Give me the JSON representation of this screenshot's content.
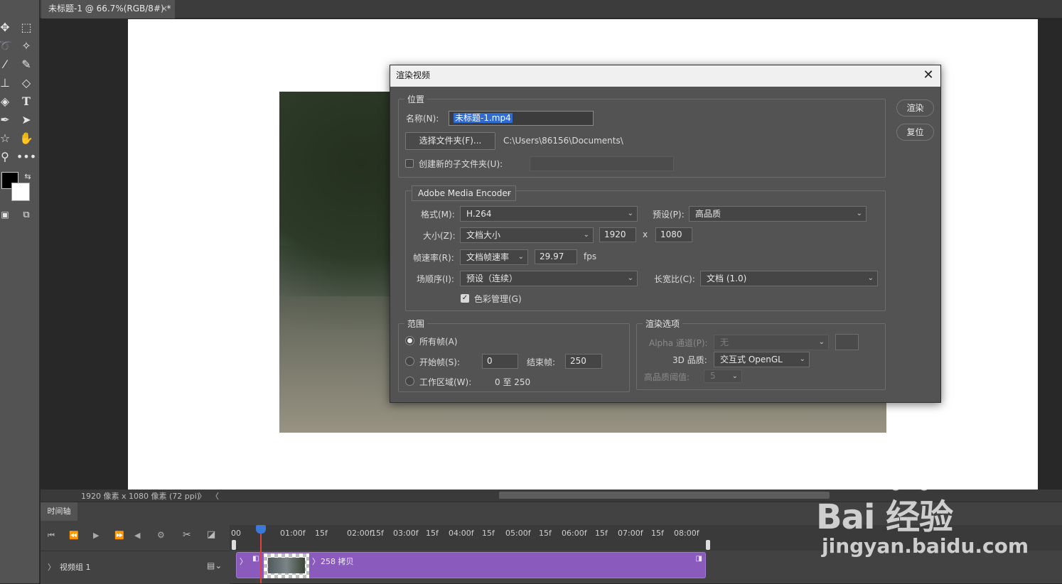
{
  "document_tab": {
    "title": "未标题-1 @ 66.7%(RGB/8#) *",
    "close": "×"
  },
  "status_bar": {
    "doc_info": "1920 像素 x 1080 像素 (72 ppi)",
    "arrow": "〉",
    "scroll_left": "〈"
  },
  "timeline": {
    "panel_title": "时间轴",
    "ticks": [
      "00",
      "01:00f",
      "15f",
      "02:00f",
      "15f",
      "03:00f",
      "15f",
      "04:00f",
      "15f",
      "05:00f",
      "15f",
      "06:00f",
      "15f",
      "07:00f",
      "15f",
      "08:00f"
    ],
    "track_label": "视频组 1",
    "clip_label": "258 拷贝"
  },
  "dialog": {
    "title": "渲染视频",
    "close": "✕",
    "location": {
      "legend": "位置",
      "name_label": "名称(N):",
      "name_value": "未标题-1.mp4",
      "select_folder_button": "选择文件夹(F)...",
      "folder_path": "C:\\Users\\86156\\Documents\\",
      "create_subfolder_label": "创建新的子文件夹(U):",
      "create_subfolder_checked": false,
      "subfolder_value": ""
    },
    "encoder": {
      "selector": "Adobe Media Encoder",
      "format_label": "格式(M):",
      "format_value": "H.264",
      "preset_label": "预设(P):",
      "preset_value": "高品质",
      "size_label": "大小(Z):",
      "size_value": "文档大小",
      "width": "1920",
      "size_x": "x",
      "height": "1080",
      "framerate_label": "帧速率(R):",
      "framerate_value": "文档帧速率",
      "fps_value": "29.97",
      "fps_unit": "fps",
      "field_order_label": "场顺序(I):",
      "field_order_value": "预设（连续）",
      "aspect_label": "长宽比(C):",
      "aspect_value": "文档 (1.0)",
      "color_mgmt_label": "色彩管理(G)",
      "color_mgmt_checked": true
    },
    "range": {
      "legend": "范围",
      "all_frames": "所有帧(A)",
      "start_frame_label": "开始帧(S):",
      "start_frame_value": "0",
      "end_frame_label": "结束帧:",
      "end_frame_value": "250",
      "work_area_label": "工作区域(W):",
      "work_area_value": "0 至 250",
      "selected": "all_frames"
    },
    "render_options": {
      "legend": "渲染选项",
      "alpha_label": "Alpha 通道(P):",
      "alpha_value": "无",
      "quality_label": "3D 品质:",
      "quality_value": "交互式 OpenGL",
      "threshold_label": "高品质阈值:",
      "threshold_value": "5"
    },
    "render_button": "渲染",
    "reset_button": "复位"
  },
  "watermark": {
    "logo": "Bai 经验",
    "url": "jingyan.baidu.com"
  }
}
